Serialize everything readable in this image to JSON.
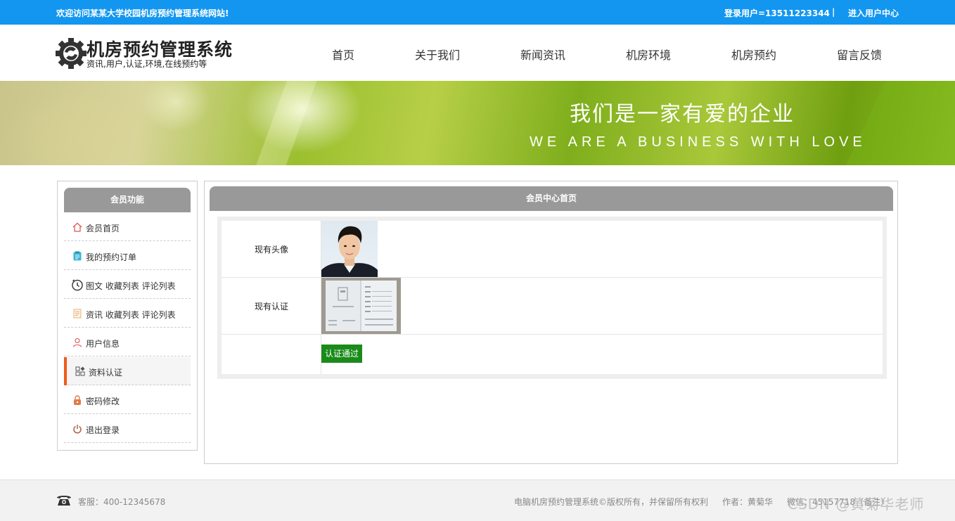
{
  "topbar": {
    "welcome": "欢迎访问某某大学校园机房预约管理系统网站!",
    "login_user": "登录用户=13511223344",
    "separator": "|",
    "user_center": "进入用户中心"
  },
  "header": {
    "title": "机房预约管理系统",
    "subtitle": "资讯,用户,认证,环境,在线预约等",
    "nav": [
      "首页",
      "关于我们",
      "新闻资讯",
      "机房环境",
      "机房预约",
      "留言反馈"
    ]
  },
  "banner": {
    "slogan": "我们是一家有爱的企业",
    "slogan_en": "WE ARE A BUSINESS WITH LOVE"
  },
  "sidebar": {
    "title": "会员功能",
    "items": [
      {
        "label": "会员首页",
        "icon": "home-icon"
      },
      {
        "label": "我的预约订单",
        "icon": "clipboard-icon"
      },
      {
        "label": "图文 收藏列表 评论列表",
        "icon": "clock-icon"
      },
      {
        "label": "资讯 收藏列表 评论列表",
        "icon": "document-icon"
      },
      {
        "label": "用户信息",
        "icon": "user-icon"
      },
      {
        "label": "资料认证",
        "icon": "grid-icon"
      },
      {
        "label": "密码修改",
        "icon": "lock-icon"
      },
      {
        "label": "退出登录",
        "icon": "power-icon"
      }
    ],
    "active_index": 5
  },
  "main": {
    "title": "会员中心首页",
    "rows": {
      "avatar_label": "现有头像",
      "cert_label": "现有认证",
      "status_button": "认证通过"
    }
  },
  "footer": {
    "service": "客服：400-12345678",
    "copyright": "电脑机房预约管理系统©版权所有，并保留所有权利",
    "author": "作者：黄菊华",
    "wechat": "微信：45157718（备注）",
    "watermark": "CSDN @黄菊华老师"
  },
  "colors": {
    "topbar": "#1296f0",
    "panel_header": "#999999",
    "active_bar": "#f05a1a",
    "verify_button": "#1a8a1a"
  }
}
